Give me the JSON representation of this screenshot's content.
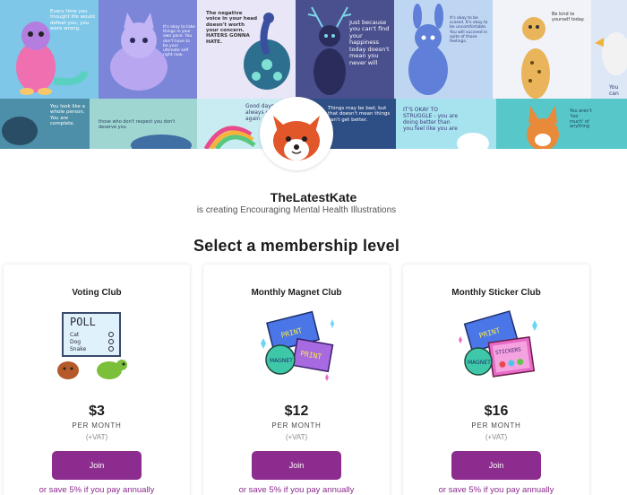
{
  "banner": {
    "tiles": [
      {
        "caption": "Every time you thought life would defeat you, you were wrong.",
        "color": "#7ec7e8"
      },
      {
        "caption": "It's okay to take things in your own pace. You don't have to be your ultimate self right now.",
        "color": "#7b86d8"
      },
      {
        "caption": "The negative voice in your head doesn't worth your concern. HATERS GONNA HATE.",
        "color": "#e9e6f7"
      },
      {
        "caption": "Just because you can't find your happiness today doesn't mean you never will",
        "color": "#4a4f8e"
      },
      {
        "caption": "It's okay to be scared. It's okay to be uncomfortable. You will succeed in spite of those feelings.",
        "color": "#bfd6f2"
      },
      {
        "caption": "Be kind to yourself today.",
        "color": "#f1f3f8"
      },
      {
        "caption": "You can",
        "color": "#dde7f6"
      },
      {
        "caption": "You look like a whole person. You are complete.",
        "color": "#4d8fa8"
      },
      {
        "caption": "those who don't respect you don't deserve you",
        "color": "#9fd6d2"
      },
      {
        "caption": "Good days will always come again",
        "color": "#c9ecf3"
      },
      {
        "caption": "Things may be bad, but that doesn't mean things can't get better.",
        "color": "#2e4f86"
      },
      {
        "caption": "IT'S OKAY TO STRUGGLE - you are doing better than you feel like you are",
        "color": "#a7e3ee"
      },
      {
        "caption": "You aren't 'too much' of anything",
        "color": "#57c7c9"
      }
    ]
  },
  "creator": {
    "name": "TheLatestKate",
    "tagline": "is creating Encouraging Mental Health Illustrations"
  },
  "section_title": "Select a membership level",
  "tiers": [
    {
      "name": "Voting Club",
      "price": "$3",
      "period": "PER MONTH",
      "vat": "(+VAT)",
      "join_label": "Join",
      "save_text": "or save 5% if you pay annually",
      "art": {
        "poll_title": "POLL",
        "poll_options": [
          "Cat",
          "Dog",
          "Snake"
        ]
      }
    },
    {
      "name": "Monthly Magnet Club",
      "price": "$12",
      "period": "PER MONTH",
      "vat": "(+VAT)",
      "join_label": "Join",
      "save_text": "or save 5% if you pay annually",
      "art": {
        "labels": [
          "PRINT",
          "MAGNET",
          "PRINT"
        ]
      }
    },
    {
      "name": "Monthly Sticker Club",
      "price": "$16",
      "period": "PER MONTH",
      "vat": "(+VAT)",
      "join_label": "Join",
      "save_text": "or save 5% if you pay annually",
      "art": {
        "labels": [
          "PRINT",
          "MAGNET",
          "STICKERS"
        ]
      }
    }
  ],
  "colors": {
    "accent": "#8c2c8e",
    "join_text": "#ffffff"
  }
}
